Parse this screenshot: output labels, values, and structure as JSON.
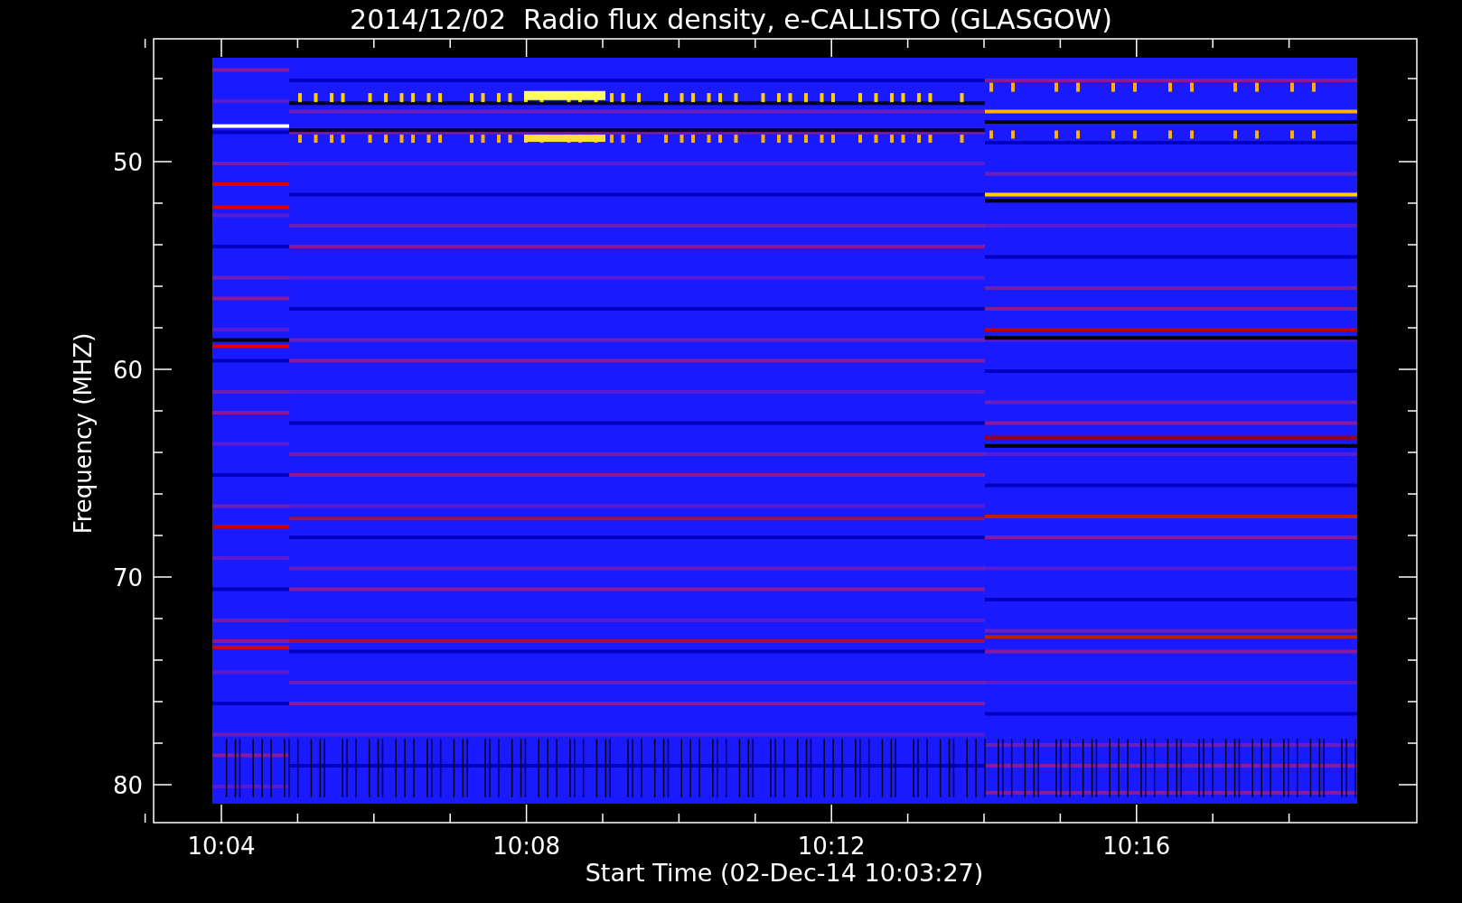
{
  "title": "2014/12/02  Radio flux density, e-CALLISTO (GLASGOW)",
  "y_axis": {
    "label": "Frequency (MHZ)",
    "ticks": [
      "50",
      "60",
      "70",
      "80"
    ]
  },
  "x_axis": {
    "label": "Start Time (02-Dec-14 10:03:27)",
    "ticks": [
      "10:04",
      "10:08",
      "10:12",
      "10:16"
    ]
  }
}
